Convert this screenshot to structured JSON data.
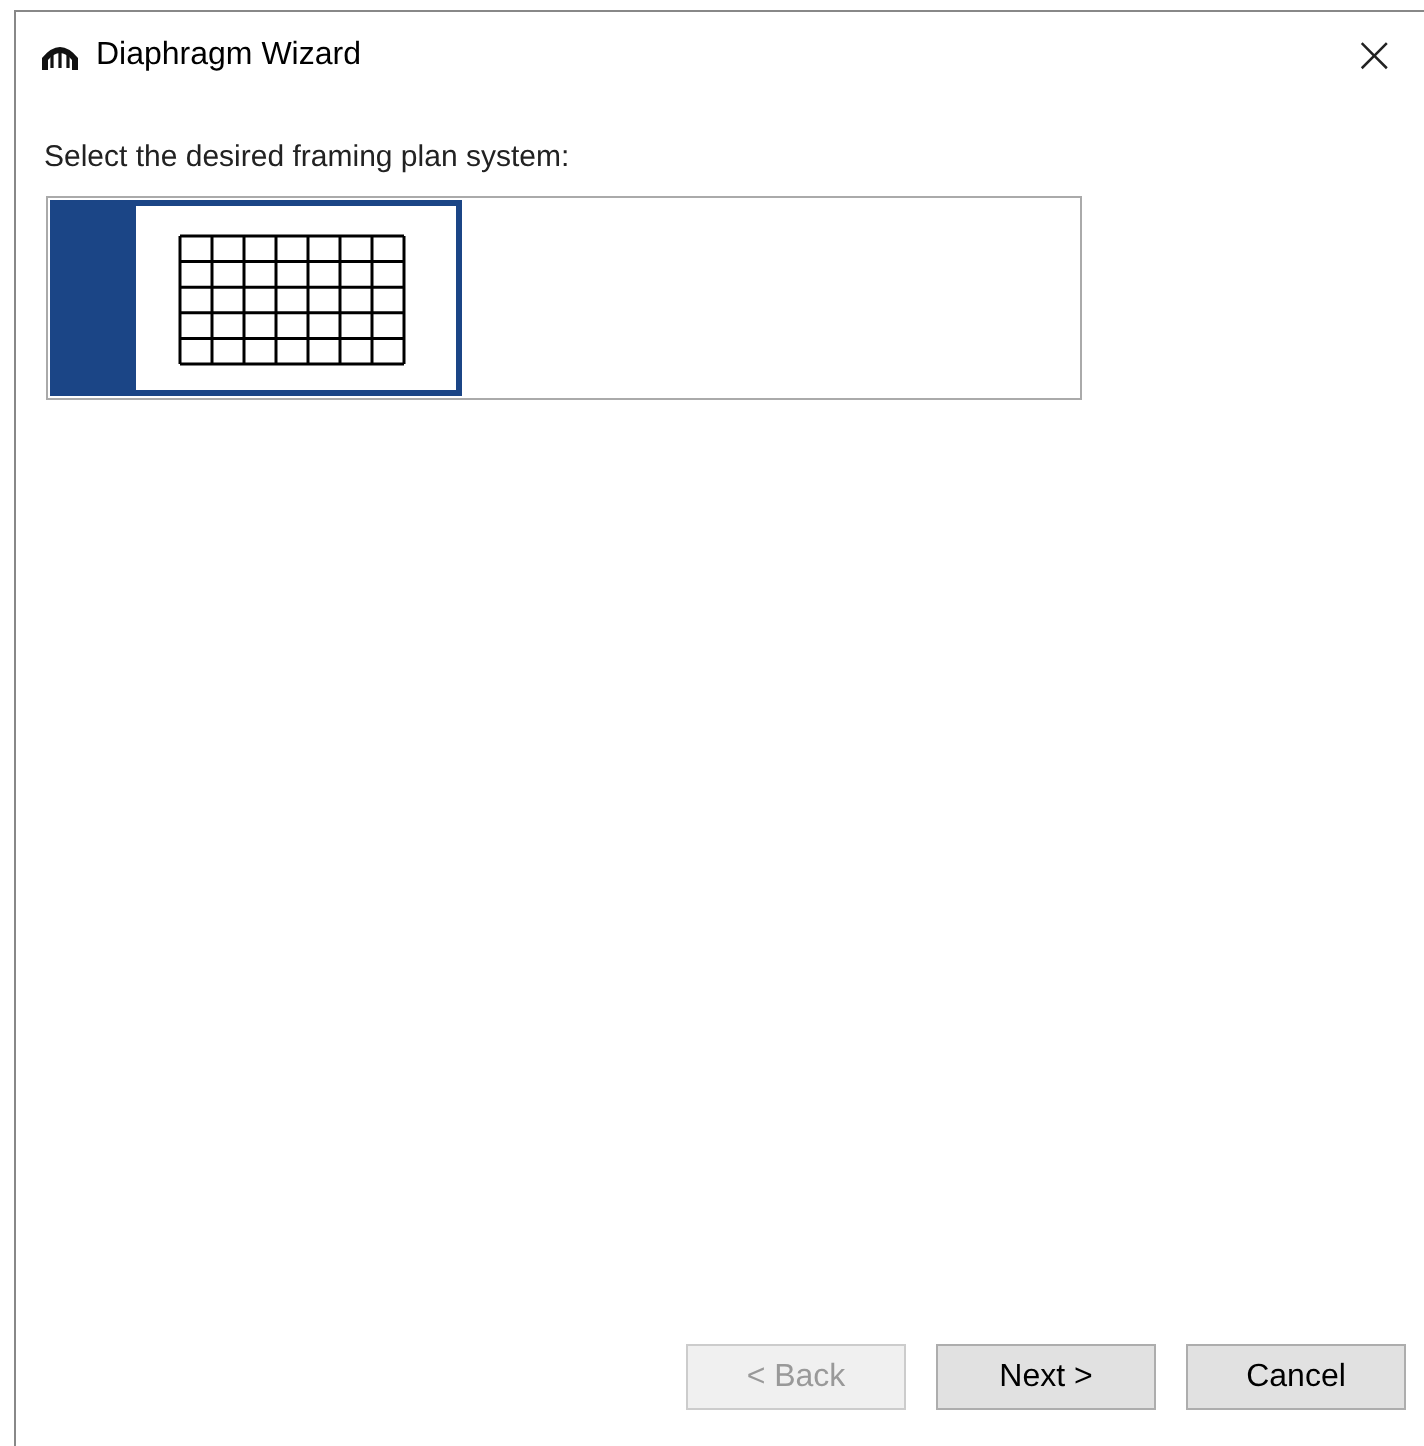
{
  "window": {
    "title": "Diaphragm Wizard",
    "close": "×"
  },
  "prompt": "Select the desired framing plan system:",
  "framing_plans": [
    {
      "kind": "grid",
      "selected": true
    }
  ],
  "buttons": [
    {
      "label": "< Back",
      "disabled": true
    },
    {
      "label": "Next >",
      "disabled": false
    },
    {
      "label": "Cancel",
      "disabled": false
    }
  ]
}
